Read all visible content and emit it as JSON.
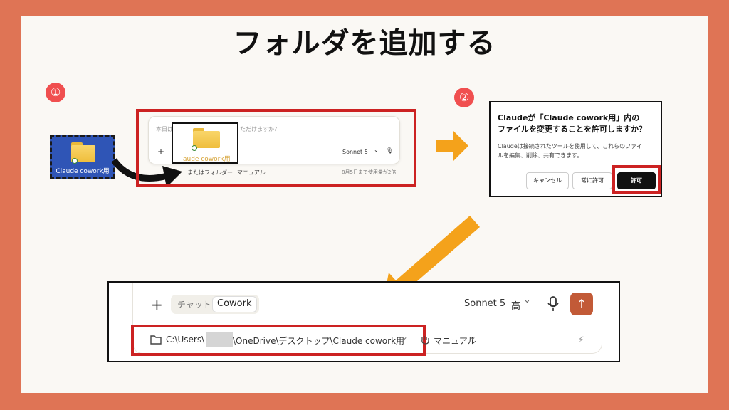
{
  "title": "フォルダを追加する",
  "steps": {
    "one": "①",
    "two": "②"
  },
  "desktop": {
    "folder_label": "Claude cowork用"
  },
  "chat_small": {
    "placeholder_part": "本日は",
    "placeholder_tail": "ただけますか？",
    "drag_label": "aude cowork用",
    "add": "+",
    "model": "Sonnet 5",
    "chevron": "⌄",
    "mic": "🎙",
    "folder_opt": "またはフォルダー",
    "manual": "マニュアル",
    "usage": "8月5日まで使用量が2倍"
  },
  "dialog": {
    "title_line1": "Claudeが「Claude cowork用」内の",
    "title_line2": "ファイルを変更することを許可しますか？",
    "body_line1": "Claudeは接続されたツールを使用して、これらのファイ",
    "body_line2": "ルを編集、削除、共有できます。",
    "cancel": "キャンセル",
    "always": "常に許可",
    "allow": "許可"
  },
  "bottom_bar": {
    "add": "+",
    "tab_chat": "チャット",
    "tab_cowork": "Cowork",
    "model": "Sonnet 5",
    "effort": "高",
    "chevron": "⌄",
    "send": "↑",
    "path_prefix": "C:\\Users\\",
    "path_suffix": "\\OneDrive\\デスクトップ\\Claude cowork用",
    "manual": "マニュアル",
    "bolt": "⚡"
  },
  "colors": {
    "accent_red": "#cc2222",
    "orange_arrow": "#f4a21b",
    "send": "#c25a37",
    "frame": "#df7455"
  }
}
